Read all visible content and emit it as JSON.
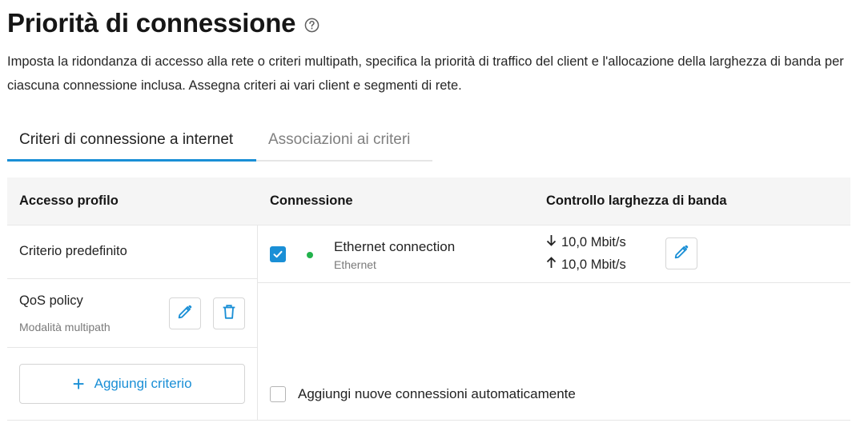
{
  "page": {
    "title": "Priorità di connessione",
    "help_icon": "question-circle-icon",
    "description": "Imposta la ridondanza di accesso alla rete o criteri multipath, specifica la priorità di traffico del client e l'allocazione della larghezza di banda per ciascuna connessione inclusa. Assegna criteri ai vari client e segmenti di rete."
  },
  "tabs": [
    {
      "label": "Criteri di connessione a internet",
      "active": true
    },
    {
      "label": "Associazioni ai criteri",
      "active": false
    }
  ],
  "table": {
    "headers": {
      "profile": "Accesso profilo",
      "connection": "Connessione",
      "bandwidth": "Controllo larghezza di banda"
    },
    "profiles": [
      {
        "name": "Criterio predefinito",
        "subtitle": ""
      },
      {
        "name": "QoS policy",
        "subtitle": "Modalità multipath",
        "actions": [
          "pencil-icon",
          "trash-icon"
        ]
      }
    ],
    "add_policy_label": "Aggiungi criterio",
    "connections": [
      {
        "checked": true,
        "status_color": "#22b24c",
        "name": "Ethernet connection",
        "type": "Ethernet",
        "download": "10,0 Mbit/s",
        "upload": "10,0 Mbit/s"
      }
    ],
    "auto_add_label": "Aggiungi nuove connessioni automaticamente",
    "auto_add_checked": false
  },
  "colors": {
    "accent": "#1a8fd6",
    "status_online": "#22b24c",
    "header_bg": "#f5f5f5"
  }
}
